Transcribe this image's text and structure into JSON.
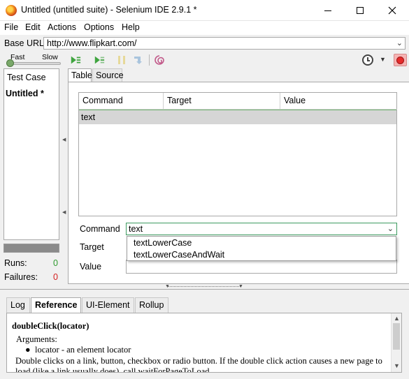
{
  "window": {
    "title": "Untitled (untitled suite) - Selenium IDE 2.9.1 *"
  },
  "menu": {
    "file": "File",
    "edit": "Edit",
    "actions": "Actions",
    "options": "Options",
    "help": "Help"
  },
  "base_url": {
    "label": "Base URL",
    "value": "http://www.flipkart.com/"
  },
  "toolbar": {
    "speed_fast": "Fast",
    "speed_slow": "Slow",
    "icons": [
      "play-all-icon",
      "play-current-icon",
      "pause-icon",
      "step-icon",
      "rollup-icon",
      "schedule-clock-icon",
      "record-icon"
    ]
  },
  "test_cases": {
    "header": "Test Case",
    "items": [
      "Untitled *"
    ]
  },
  "stats": {
    "runs_label": "Runs:",
    "runs_value": "0",
    "failures_label": "Failures:",
    "failures_value": "0",
    "runs_color": "#2e9a2e",
    "failures_color": "#d42020"
  },
  "editor": {
    "tabs": [
      "Table",
      "Source"
    ],
    "active_tab": "Table",
    "columns": [
      "Command",
      "Target",
      "Value"
    ],
    "rows": [
      {
        "command": "text",
        "target": "",
        "value": ""
      }
    ],
    "command_label": "Command",
    "target_label": "Target",
    "value_label": "Value",
    "command_value": "text",
    "autocomplete": [
      "textLowerCase",
      "textLowerCaseAndWait"
    ]
  },
  "bottom": {
    "tabs": [
      "Log",
      "Reference",
      "UI-Element",
      "Rollup"
    ],
    "active_tab": "Reference",
    "reference": {
      "title": "doubleClick(locator)",
      "args_label": "Arguments:",
      "arg": "locator - an element locator",
      "description": "Double clicks on a link, button, checkbox or radio button. If the double click action causes a new page to load (like a link usually does), call waitForPageToLoad."
    }
  }
}
